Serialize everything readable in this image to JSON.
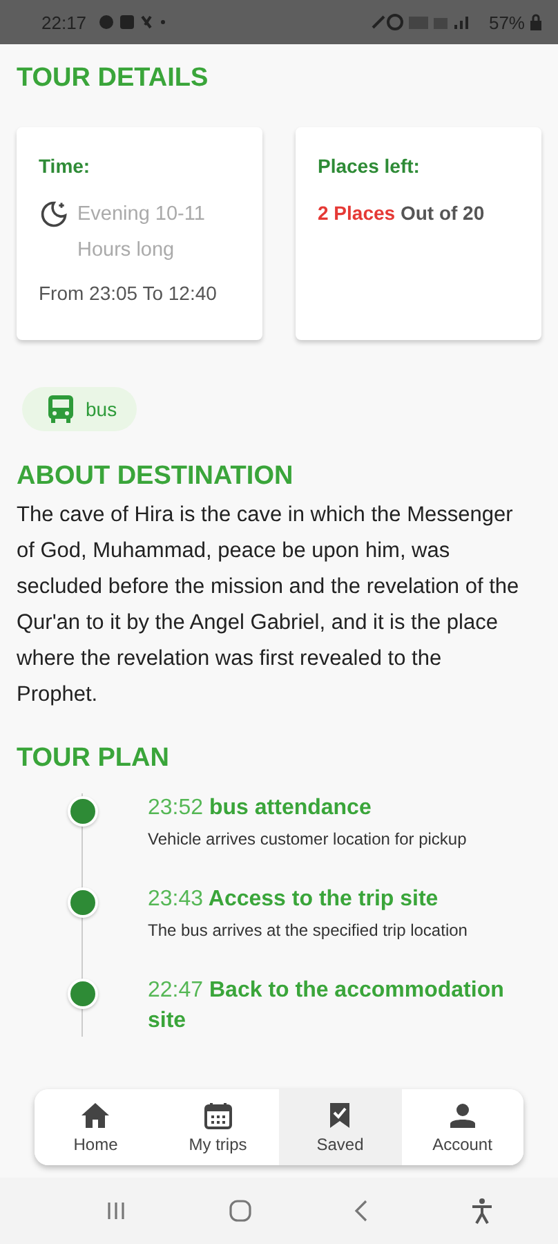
{
  "status_bar": {
    "time": "22:17",
    "battery": "57%"
  },
  "tour_details": {
    "title": "TOUR DETAILS",
    "cards": [
      {
        "kind": "time",
        "label": "Time:",
        "period": "Evening 10-11 Hours long",
        "range": "From 23:05 To 12:40"
      },
      {
        "kind": "places",
        "label": "Places left:",
        "highlight": "2 Places",
        "rest": "Out of 20"
      }
    ]
  },
  "transport": {
    "label": "bus"
  },
  "about": {
    "title": "ABOUT DESTINATION",
    "text": "The cave of Hira is the cave in which the Messenger of God, Muhammad, peace be upon him, was secluded before the mission and the revelation of the Qur'an to it by the Angel Gabriel, and it is the place where the revelation was first revealed to the Prophet."
  },
  "plan": {
    "title": "TOUR PLAN",
    "items": [
      {
        "time": "23:52",
        "title": "bus attendance",
        "description": "Vehicle arrives customer location for pickup"
      },
      {
        "time": "23:43",
        "title": "Access to the trip site",
        "description": "The bus arrives at the specified trip location"
      },
      {
        "time": "22:47",
        "title": "Back to the accommodation site"
      }
    ]
  },
  "bottom_nav": [
    {
      "label": "Home",
      "selected": false
    },
    {
      "label": "My trips",
      "selected": false
    },
    {
      "label": "Saved",
      "selected": true
    },
    {
      "label": "Account",
      "selected": false
    }
  ]
}
